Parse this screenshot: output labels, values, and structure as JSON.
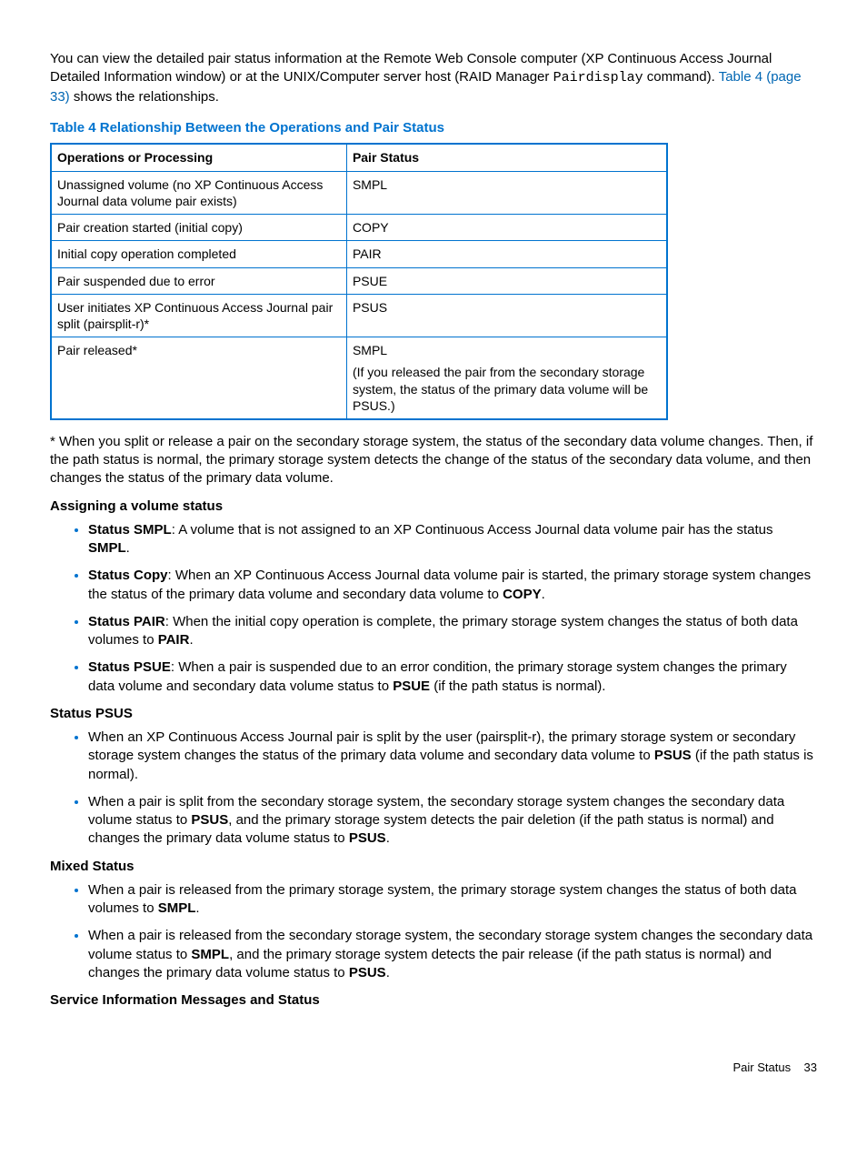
{
  "intro": {
    "line1_pre": "You can view the detailed pair status information at the Remote Web Console computer (XP Continuous Access Journal Detailed Information window) or at the UNIX/Computer server host (RAID Manager ",
    "mono": "Pairdisplay",
    "line1_mid": " command). ",
    "link": "Table 4 (page 33)",
    "line1_post": " shows the relationships."
  },
  "table": {
    "title": "Table 4 Relationship Between the Operations and Pair Status",
    "header": {
      "c1": "Operations or Processing",
      "c2": "Pair Status"
    },
    "rows": [
      {
        "c1": "Unassigned volume (no XP Continuous Access Journal data volume pair exists)",
        "c2": "SMPL"
      },
      {
        "c1": "Pair creation started (initial copy)",
        "c2": "COPY"
      },
      {
        "c1": "Initial copy operation completed",
        "c2": "PAIR"
      },
      {
        "c1": "Pair suspended due to error",
        "c2": "PSUE"
      },
      {
        "c1": "User initiates XP Continuous Access Journal pair split (pairsplit-r)*",
        "c2": "PSUS"
      },
      {
        "c1": "Pair released*",
        "c2": "SMPL",
        "extra": "(If you released the pair from the secondary storage system, the status of the primary data volume will be PSUS.)"
      }
    ]
  },
  "footnote": "* When you split or release a pair on the secondary storage system, the status of the secondary data volume changes. Then, if the path status is normal, the primary storage system detects the change of the status of the secondary data volume, and then changes the status of the primary data volume.",
  "assign_head": "Assigning a volume status",
  "assign": [
    {
      "b1": "Status SMPL",
      "t": ": A volume that is not assigned to an XP Continuous Access Journal data volume pair has the status ",
      "b2": "SMPL",
      "tail": "."
    },
    {
      "b1": "Status Copy",
      "t": ": When an XP Continuous Access Journal data volume pair is started, the primary storage system changes the status of the primary data volume and secondary data volume to ",
      "b2": "COPY",
      "tail": "."
    },
    {
      "b1": "Status PAIR",
      "t": ": When the initial copy operation is complete, the primary storage system changes the status of both data volumes to ",
      "b2": "PAIR",
      "tail": "."
    },
    {
      "b1": "Status PSUE",
      "t": ": When a pair is suspended due to an error condition, the primary storage system changes the primary data volume and secondary data volume status to ",
      "b2": "PSUE",
      "tail": " (if the path status is normal)."
    }
  ],
  "psus_head": "Status PSUS",
  "psus": [
    {
      "pre": "When an XP Continuous Access Journal pair is split by the user (pairsplit-r), the primary storage system or secondary storage system changes the status of the primary data volume and secondary data volume to ",
      "b1": "PSUS",
      "mid": " (if the path status is normal).",
      "b2": "",
      "post": ""
    },
    {
      "pre": "When a pair is split from the secondary storage system, the secondary storage system changes the secondary data volume status to ",
      "b1": "PSUS",
      "mid": ", and the primary storage system detects the pair deletion (if the path status is normal) and changes the primary data volume status to ",
      "b2": "PSUS",
      "post": "."
    }
  ],
  "mixed_head": "Mixed Status",
  "mixed": [
    {
      "pre": "When a pair is released from the primary storage system, the primary storage system changes the status of both data volumes to ",
      "b1": "SMPL",
      "mid": ".",
      "b2": "",
      "post": ""
    },
    {
      "pre": "When a pair is released from the secondary storage system, the secondary storage system changes the secondary data volume status to ",
      "b1": "SMPL",
      "mid": ", and the primary storage system detects the pair release (if the path status is normal) and changes the primary data volume status to ",
      "b2": "PSUS",
      "post": "."
    }
  ],
  "svc_head": "Service Information Messages and Status",
  "footer": {
    "label": "Pair Status",
    "page": "33"
  }
}
